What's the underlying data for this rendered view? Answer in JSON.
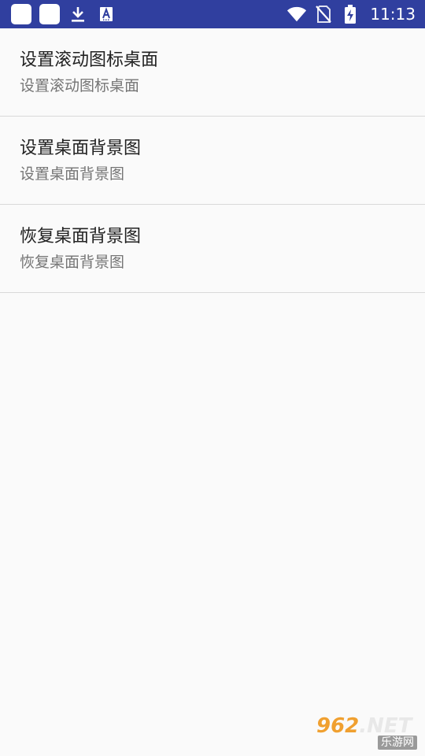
{
  "status_bar": {
    "time": "11:13",
    "left_icons": [
      "app-placeholder-icon",
      "app-placeholder-icon",
      "download-icon",
      "font-a-icon"
    ],
    "right_icons": [
      "wifi-icon",
      "no-sim-icon",
      "battery-charging-icon"
    ],
    "background_color": "#303f9f"
  },
  "list": {
    "items": [
      {
        "title": "设置滚动图标桌面",
        "subtitle": "设置滚动图标桌面"
      },
      {
        "title": "设置桌面背景图",
        "subtitle": "设置桌面背景图"
      },
      {
        "title": "恢复桌面背景图",
        "subtitle": "恢复桌面背景图"
      }
    ]
  },
  "watermark": {
    "number": "962",
    "domain": ".NET",
    "site_name": "乐游网"
  }
}
